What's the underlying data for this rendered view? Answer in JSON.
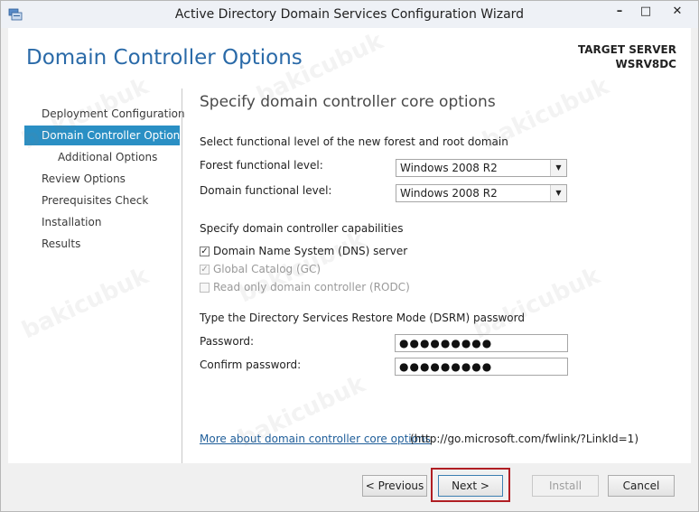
{
  "window": {
    "title": "Active Directory Domain Services Configuration Wizard",
    "minimize_glyph": "–",
    "maximize_glyph": "□",
    "close_glyph": "✕"
  },
  "header": {
    "page_title": "Domain Controller Options",
    "target_label": "TARGET SERVER",
    "target_name": "WSRV8DC"
  },
  "nav": {
    "items": [
      {
        "label": "Deployment Configuration"
      },
      {
        "label": "Domain Controller Options"
      },
      {
        "label": "Additional Options"
      },
      {
        "label": "Review Options"
      },
      {
        "label": "Prerequisites Check"
      },
      {
        "label": "Installation"
      },
      {
        "label": "Results"
      }
    ],
    "active_label": "Domain Controller Options"
  },
  "main": {
    "section_title": "Specify domain controller core options",
    "functional_heading": "Select functional level of the new forest and root domain",
    "forest_label": "Forest functional level:",
    "forest_value": "Windows 2008 R2",
    "domain_label": "Domain functional level:",
    "domain_value": "Windows 2008 R2",
    "capabilities_heading": "Specify domain controller capabilities",
    "checkboxes": [
      {
        "label": "Domain Name System (DNS) server",
        "checked": true,
        "enabled": true
      },
      {
        "label": "Global Catalog (GC)",
        "checked": true,
        "enabled": false
      },
      {
        "label": "Read only domain controller (RODC)",
        "checked": false,
        "enabled": false
      }
    ],
    "check_glyph": "✓",
    "dsrm_heading": "Type the Directory Services Restore Mode (DSRM) password",
    "password_label": "Password:",
    "password_value": "●●●●●●●●●",
    "confirm_label": "Confirm password:",
    "confirm_value": "●●●●●●●●●",
    "more_link": "More about domain controller core options",
    "more_url": "(http://go.microsoft.com/fwlink/?LinkId=1)",
    "dropdown_glyph": "▼"
  },
  "footer": {
    "previous_label": "< Previous",
    "next_label": "Next >",
    "install_label": "Install",
    "cancel_label": "Cancel"
  },
  "watermark": {
    "text": "bakicubuk"
  },
  "colors": {
    "accent": "#2a8fc4",
    "title_blue": "#2a6aa8",
    "link": "#1e5d99",
    "highlight_red": "#b01e23"
  }
}
